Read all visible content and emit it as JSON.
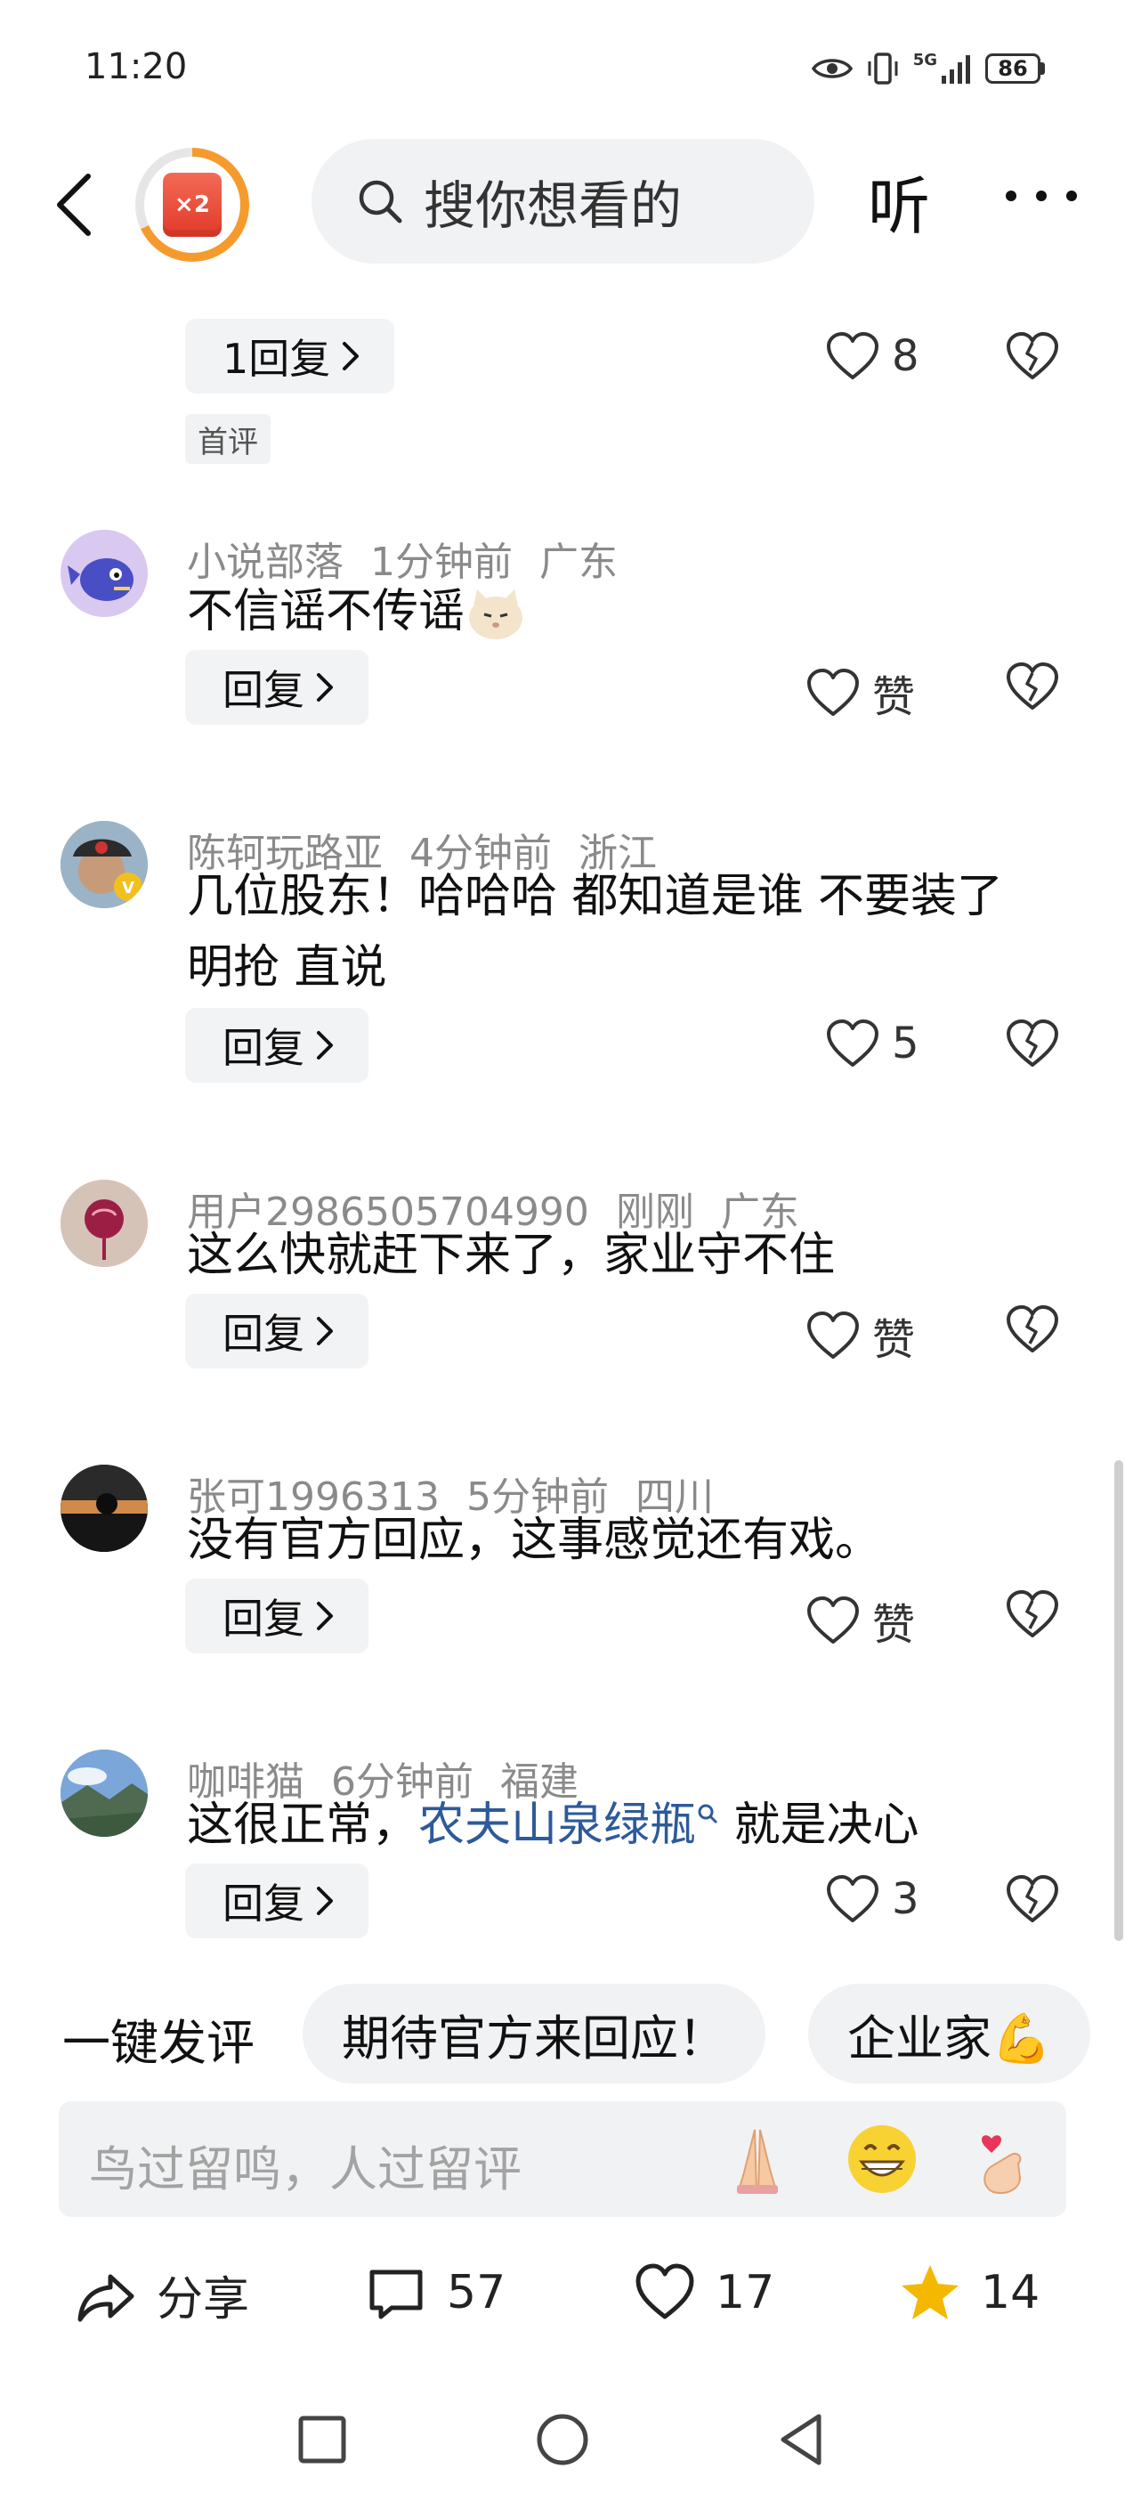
{
  "status_bar": {
    "time": "11:20",
    "network": "5G",
    "battery": "86"
  },
  "top_nav": {
    "reward_badge": "×2",
    "search_placeholder": "搜你想看的",
    "listen_label": "听"
  },
  "comments_top": {
    "reply_label": "1回复",
    "like_count": "8",
    "tag": "首评"
  },
  "comments": [
    {
      "user": "小说部落",
      "time": "1分钟前",
      "location": "广东",
      "text": "不信谣不传谣",
      "reply_label": "回复",
      "like_label": "赞"
    },
    {
      "user": "陈轲玩路亚",
      "time": "4分钟前",
      "location": "浙江",
      "text": "几位股东！哈哈哈 都知道是谁 不要装了 明抢 直说",
      "reply_label": "回复",
      "like_label": "5"
    },
    {
      "user": "用户2986505704990",
      "time": "刚刚",
      "location": "广东",
      "text": "这么快就赶下来了，家业守不住",
      "reply_label": "回复",
      "like_label": "赞"
    },
    {
      "user": "张可1996313",
      "time": "5分钟前",
      "location": "四川",
      "text": "没有官方回应，这事感觉还有戏。",
      "reply_label": "回复",
      "like_label": "赞"
    },
    {
      "user": "咖啡猫",
      "time": "6分钟前",
      "location": "福建",
      "text_before": "这很正常，",
      "text_link": "农夫山泉绿瓶",
      "text_after": " 就是决心",
      "reply_label": "回复",
      "like_label": "3"
    }
  ],
  "quick_comments": {
    "label": "一键发评",
    "chips": [
      "期待官方来回应！",
      "企业家💪"
    ]
  },
  "input": {
    "placeholder": "鸟过留鸣，人过留评"
  },
  "action_bar": {
    "share_label": "分享",
    "comment_count": "57",
    "like_count": "17",
    "favorite_count": "14"
  },
  "colors": {
    "accent_link": "#2d5a9a",
    "badge_orange": "#f59b2e",
    "star_yellow": "#f5b800"
  }
}
